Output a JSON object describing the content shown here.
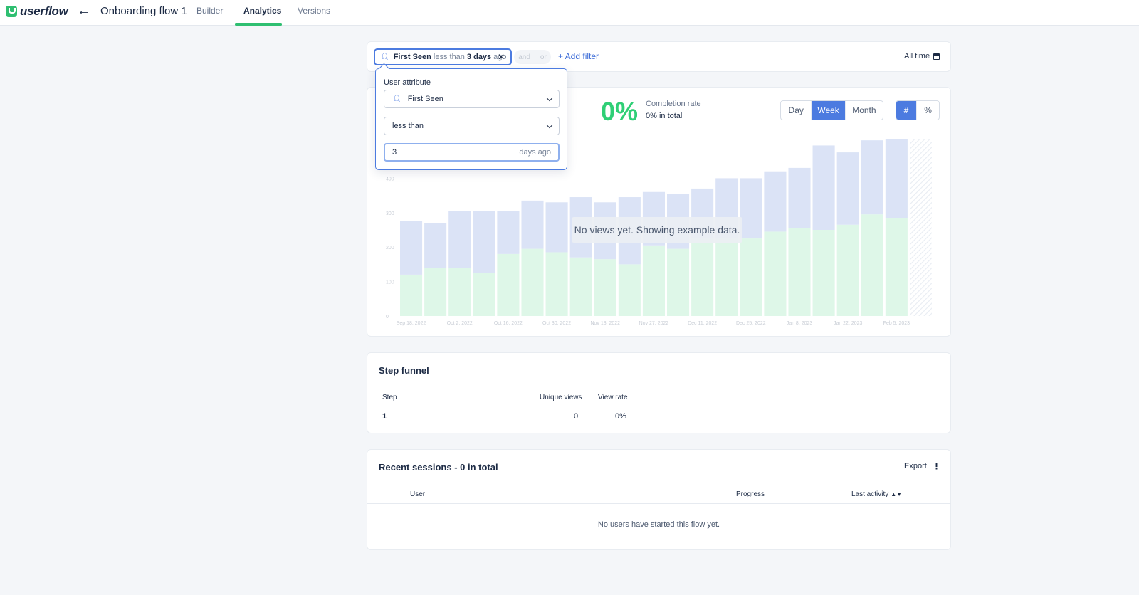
{
  "app": {
    "logo_text": "userflow",
    "flow_title": "Onboarding flow 1"
  },
  "tabs": [
    {
      "label": "Builder",
      "active": false
    },
    {
      "label": "Analytics",
      "active": true
    },
    {
      "label": "Versions",
      "active": false
    }
  ],
  "filter": {
    "attribute": "First Seen",
    "operator": "less than",
    "value": "3 days",
    "suffix": "ago",
    "and_label": "and",
    "or_label": "or",
    "add_filter_label": "+ Add filter",
    "date_range": "All time"
  },
  "filter_popover": {
    "label": "User attribute",
    "attribute_select": "First Seen",
    "operator_select": "less than",
    "value_input": "3",
    "value_suffix": "days ago"
  },
  "stats": {
    "completion_value": "0%",
    "completion_label": "Completion rate",
    "completion_total": "0% in total"
  },
  "period_toggle": {
    "options": [
      "Day",
      "Week",
      "Month"
    ],
    "selected": "Week"
  },
  "unit_toggle": {
    "options": [
      "#",
      "%"
    ],
    "selected": "#"
  },
  "chart_note": "No views yet. Showing example data.",
  "chart_data": {
    "type": "bar",
    "stacked": true,
    "ylim": [
      0,
      500
    ],
    "yticks": [
      0,
      100,
      200,
      300,
      400
    ],
    "categories": [
      "Sep 18, 2022",
      "",
      "Oct 2, 2022",
      "",
      "Oct 16, 2022",
      "",
      "Oct 30, 2022",
      "",
      "Nov 13, 2022",
      "",
      "Nov 27, 2022",
      "",
      "Dec 11, 2022",
      "",
      "Dec 25, 2022",
      "",
      "Jan 8, 2023",
      "",
      "Jan 22, 2023",
      "",
      "Feb 5, 2023",
      ""
    ],
    "series": [
      {
        "values": [
          120,
          140,
          140,
          125,
          180,
          195,
          185,
          170,
          165,
          150,
          205,
          195,
          225,
          225,
          225,
          245,
          255,
          250,
          265,
          295,
          285,
          275
        ]
      },
      {
        "values": [
          155,
          130,
          165,
          180,
          125,
          140,
          145,
          175,
          165,
          195,
          155,
          160,
          145,
          175,
          175,
          175,
          175,
          245,
          210,
          215,
          240,
          245
        ]
      }
    ],
    "last_bar_partial": true,
    "colors": {
      "completed": "#def7e8",
      "started": "#dbe3f6",
      "hatch": "#e8ecf3"
    }
  },
  "step_funnel": {
    "title": "Step funnel",
    "columns": [
      "Step",
      "Unique views",
      "View rate"
    ],
    "rows": [
      {
        "step": "1",
        "unique_views": "0",
        "view_rate": "0%"
      }
    ]
  },
  "recent_sessions": {
    "title": "Recent sessions - 0 in total",
    "export_label": "Export",
    "columns": [
      "User",
      "Progress",
      "Last activity"
    ],
    "empty_message": "No users have started this flow yet."
  }
}
